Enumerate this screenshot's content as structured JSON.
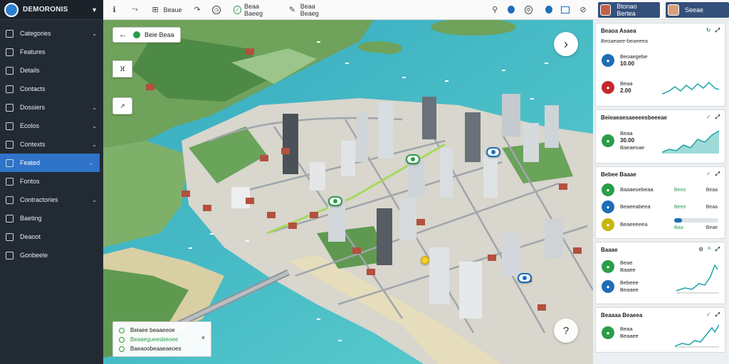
{
  "app": {
    "name": "DEMORONIS"
  },
  "sidebar": {
    "items": [
      {
        "label": "Categories",
        "chevron": true,
        "active": false
      },
      {
        "label": "Features",
        "chevron": false,
        "active": false
      },
      {
        "label": "Details",
        "chevron": false,
        "active": false
      },
      {
        "label": "Contacts",
        "chevron": false,
        "active": false
      },
      {
        "label": "Dossiers",
        "chevron": true,
        "active": false
      },
      {
        "label": "Ecolos",
        "chevron": true,
        "active": false
      },
      {
        "label": "Contexts",
        "chevron": true,
        "active": false
      },
      {
        "label": "Feated",
        "chevron": true,
        "active": true
      },
      {
        "label": "Fontos",
        "chevron": false,
        "active": false
      },
      {
        "label": "Contractories",
        "chevron": true,
        "active": false
      },
      {
        "label": "Baeting",
        "chevron": false,
        "active": false
      },
      {
        "label": "Deaoot",
        "chevron": false,
        "active": false
      },
      {
        "label": "Gonbeele",
        "chevron": false,
        "active": false
      }
    ]
  },
  "toolbar": {
    "label_a": "Beaue",
    "label_b": "Beaa Baeeg",
    "label_c": "Beaa Beaeg",
    "user1": "Btonao Bertea",
    "user2": "Seeae"
  },
  "map": {
    "chip_label": "Beie Beaa",
    "legend": [
      {
        "label": "Beiaee beaaeeoe",
        "value": ""
      },
      {
        "label": "Beaaegueesbeoee",
        "value": ""
      },
      {
        "label": "Baeaoobeaaeaeoes",
        "value": ""
      }
    ],
    "legend_close": "×"
  },
  "panel": {
    "card1": {
      "title": "Beaoa Asaea",
      "subtitle": "Beoaeaee-beaeeea",
      "m1_label": "Beoaegebe",
      "m1_value": "10.00",
      "m2_label": "Beaa",
      "m2_value": "2.00"
    },
    "card2": {
      "title": "Beieaeaesaeeeesbeeeae",
      "m1_label": "Beaa",
      "m1_value": "30.00",
      "m1_sub": "Baeaeoae"
    },
    "card3": {
      "title": "Bebee Baaae",
      "rows": [
        {
          "label": "Baaaeoebeaa",
          "mid": "Beoo",
          "right": "Beaa"
        },
        {
          "label": "Beaeeabeea",
          "mid": "Beee",
          "right": "Beaa"
        },
        {
          "label": "Beaeeeeea",
          "mid": "Baa",
          "right": "Beae"
        }
      ],
      "progress": 0.18
    },
    "card4": {
      "title": "Baaae",
      "m1_label": "Beae",
      "m1_value": "Baaee",
      "m2_label": "Bebeee",
      "m2_value": "Beaaee"
    },
    "card5": {
      "title": "Beaaaa Beaeea",
      "m1_label": "Beaa",
      "m1_value": "Beaaee"
    }
  },
  "colors": {
    "sidebar_bg": "#222a33",
    "accent": "#2f73c9",
    "green": "#2a9d4a",
    "red": "#c4272c",
    "water": "#4fc1c9"
  }
}
